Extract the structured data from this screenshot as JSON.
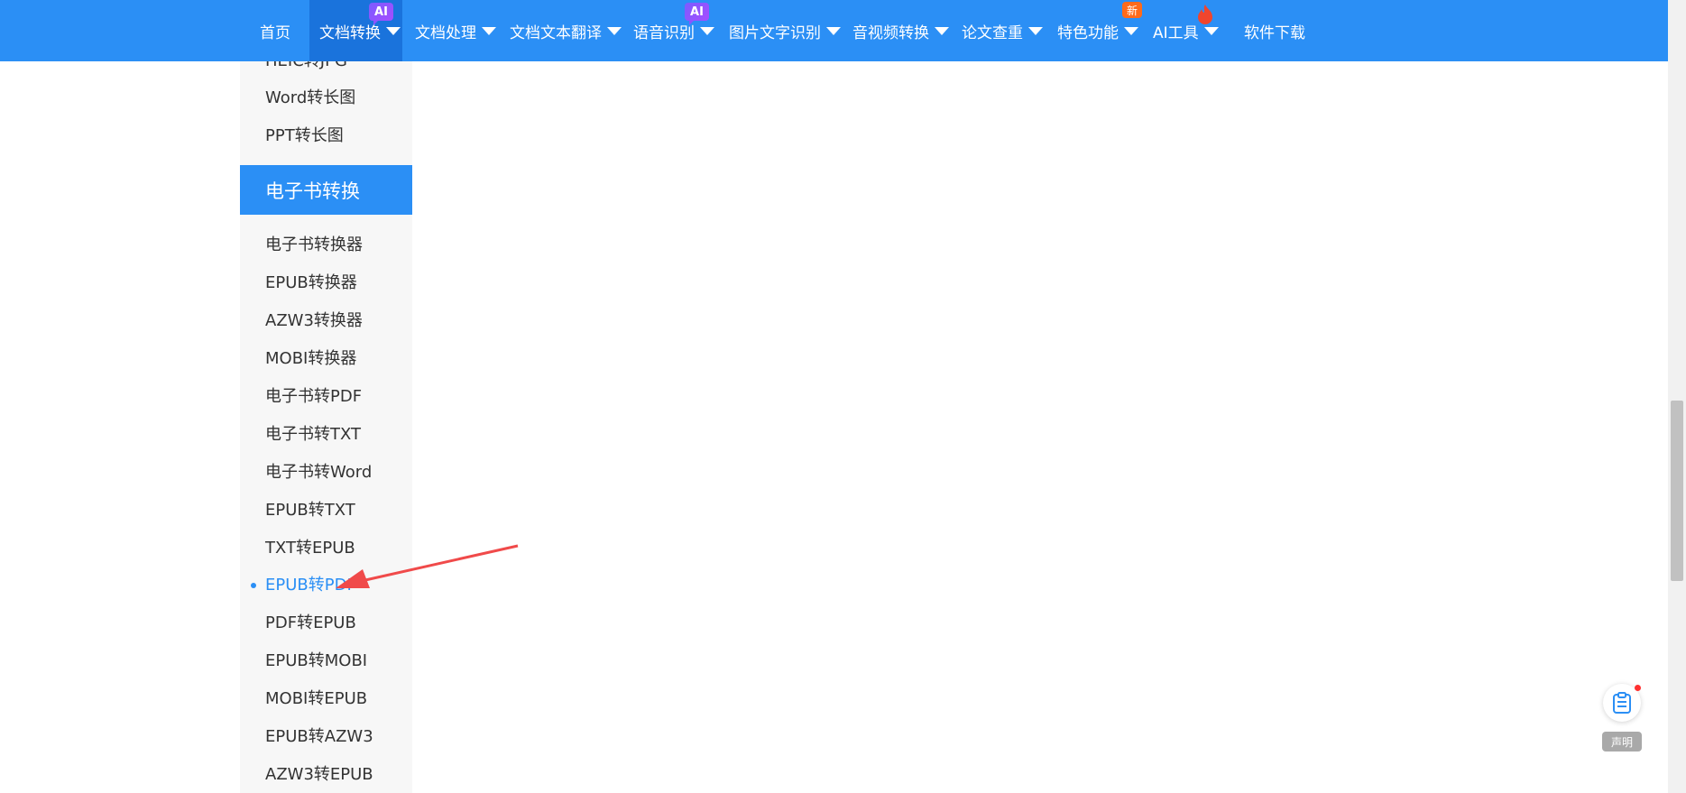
{
  "nav": {
    "items": [
      {
        "label": "首页"
      },
      {
        "label": "文档转换",
        "badge": "AI"
      },
      {
        "label": "文档处理"
      },
      {
        "label": "文档文本翻译"
      },
      {
        "label": "语音识别",
        "badge": "AI"
      },
      {
        "label": "图片文字识别"
      },
      {
        "label": "音视频转换"
      },
      {
        "label": "论文查重"
      },
      {
        "label": "特色功能",
        "badge": "新"
      },
      {
        "label": "AI工具"
      },
      {
        "label": "软件下载"
      }
    ],
    "colors": {
      "bar": "#2b8ff5",
      "active": "#1a73dc"
    }
  },
  "sidebar": {
    "partial_top_label": "HEIC转JPG",
    "pre_items": [
      "Word转长图",
      "PPT转长图"
    ],
    "section_title": "电子书转换",
    "items": [
      "电子书转换器",
      "EPUB转换器",
      "AZW3转换器",
      "MOBI转换器",
      "电子书转PDF",
      "电子书转TXT",
      "电子书转Word",
      "EPUB转TXT",
      "TXT转EPUB",
      "EPUB转PDF",
      "PDF转EPUB",
      "EPUB转MOBI",
      "MOBI转EPUB",
      "EPUB转AZW3",
      "AZW3转EPUB"
    ],
    "active_item": "EPUB转PDF"
  },
  "float_button": {
    "label": "声明",
    "icon": "clipboard-icon"
  },
  "annotation": {
    "color": "#f04a4a",
    "type": "arrow"
  }
}
